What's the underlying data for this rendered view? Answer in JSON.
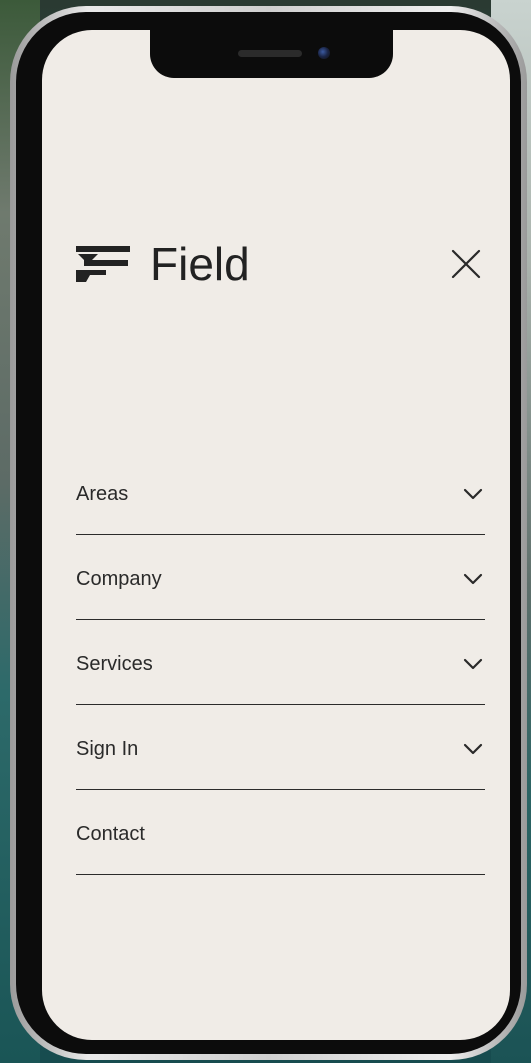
{
  "brand": {
    "name": "Field",
    "logo_icon": "field-logo-mark"
  },
  "header": {
    "close_icon": "close-icon"
  },
  "menu": {
    "items": [
      {
        "label": "Areas",
        "has_submenu": true
      },
      {
        "label": "Company",
        "has_submenu": true
      },
      {
        "label": "Services",
        "has_submenu": true
      },
      {
        "label": "Sign In",
        "has_submenu": true
      },
      {
        "label": "Contact",
        "has_submenu": false
      }
    ]
  },
  "colors": {
    "background": "#f0ece7",
    "text": "#2a2a2a",
    "divider": "#2b2b2b"
  }
}
